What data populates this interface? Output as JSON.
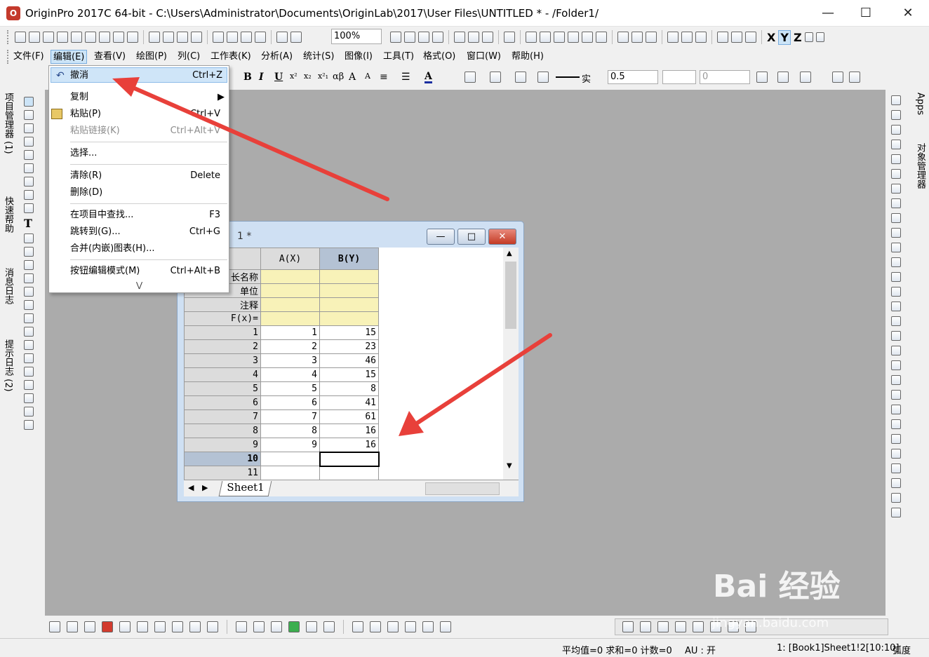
{
  "window": {
    "title": "OriginPro 2017C 64-bit - C:\\Users\\Administrator\\Documents\\OriginLab\\2017\\User Files\\UNTITLED * - /Folder1/"
  },
  "toolbar": {
    "zoom": "100%",
    "line_style": "实",
    "line_width": "0.5",
    "number_field": "0"
  },
  "menubar": [
    "文件(F)",
    "编辑(E)",
    "查看(V)",
    "绘图(P)",
    "列(C)",
    "工作表(K)",
    "分析(A)",
    "统计(S)",
    "图像(I)",
    "工具(T)",
    "格式(O)",
    "窗口(W)",
    "帮助(H)"
  ],
  "edit_menu": {
    "undo": {
      "label": "撤消",
      "key": "Ctrl+Z"
    },
    "copy": {
      "label": "复制"
    },
    "paste": {
      "label": "粘贴(P)",
      "key": "Ctrl+V"
    },
    "paste_link": {
      "label": "粘贴链接(K)",
      "key": "Ctrl+Alt+V"
    },
    "select": {
      "label": "选择..."
    },
    "clear": {
      "label": "清除(R)",
      "key": "Delete"
    },
    "delete": {
      "label": "删除(D)"
    },
    "find": {
      "label": "在项目中查找...",
      "key": "F3"
    },
    "goto": {
      "label": "跳转到(G)...",
      "key": "Ctrl+G"
    },
    "merge": {
      "label": "合并(内嵌)图表(H)..."
    },
    "button_edit": {
      "label": "按钮编辑模式(M)",
      "key": "Ctrl+Alt+B"
    }
  },
  "left_tabs": [
    "项目管理器 (1)",
    "快速帮助",
    "消息日志",
    "提示日志 (2)"
  ],
  "right_tabs": [
    "Apps",
    "对象管理器"
  ],
  "worksheet": {
    "title_suffix": "1 *",
    "columns": [
      "A(X)",
      "B(Y)"
    ],
    "meta_rows": [
      "长名称",
      "单位",
      "注释",
      "F(x)="
    ],
    "rows": [
      {
        "n": "1",
        "a": "1",
        "b": "15"
      },
      {
        "n": "2",
        "a": "2",
        "b": "23"
      },
      {
        "n": "3",
        "a": "3",
        "b": "46"
      },
      {
        "n": "4",
        "a": "4",
        "b": "15"
      },
      {
        "n": "5",
        "a": "5",
        "b": "8"
      },
      {
        "n": "6",
        "a": "6",
        "b": "41"
      },
      {
        "n": "7",
        "a": "7",
        "b": "61"
      },
      {
        "n": "8",
        "a": "8",
        "b": "16"
      },
      {
        "n": "9",
        "a": "9",
        "b": "16"
      },
      {
        "n": "10",
        "a": "",
        "b": ""
      },
      {
        "n": "11",
        "a": "",
        "b": ""
      }
    ],
    "sheet_tab": "Sheet1"
  },
  "statusbar": {
    "stats": "平均值=0 求和=0 计数=0",
    "au": "AU : 开",
    "position": "1: [Book1]Sheet1!2[10:10]",
    "angle": "弧度"
  },
  "watermark": {
    "main": "Bai 经验",
    "sub": "jingyan.baidu.com"
  },
  "colors": {
    "arrow": "#e8403a",
    "workspace": "#ababab",
    "meta_rows": "#f8f2b8",
    "highlight": "#cfe5f8"
  }
}
